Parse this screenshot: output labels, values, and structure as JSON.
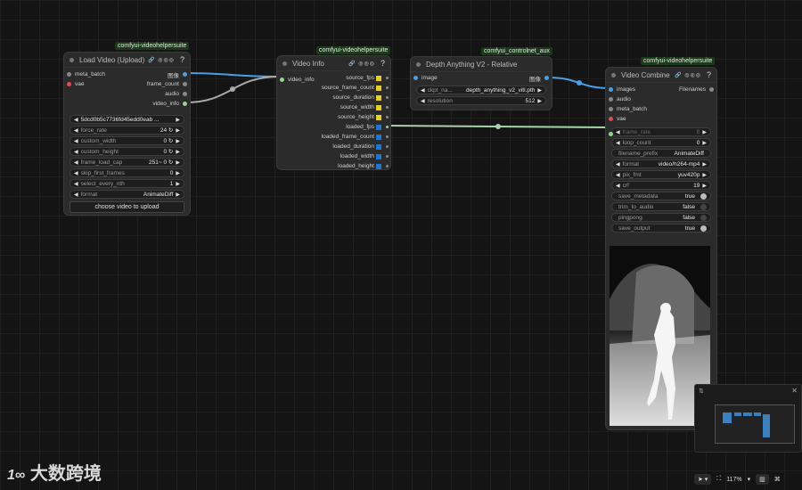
{
  "links_colors": {
    "image": "#4aa0e6",
    "info": "#aaaaaa",
    "fps": "#aad2aa"
  },
  "packs": {
    "p1": "comfyui-videohelpersuite",
    "p2": "comfyui-videohelpersuite",
    "p3": "comfyui_controlnet_aux",
    "p4": "comfyui-videohelpersuite"
  },
  "load_video": {
    "title": "Load Video (Upload)",
    "badges": "🔗 ◎◎◎",
    "help": "?",
    "inputs": [
      "meta_batch",
      "vae"
    ],
    "outputs": [
      "图像",
      "frame_count",
      "audio",
      "video_info"
    ],
    "widgets": [
      {
        "label": "",
        "value": "5dcd0b5c7736fd45edd0eab ..."
      },
      {
        "label": "force_rate",
        "value": "24 ↻"
      },
      {
        "label": "custom_width",
        "value": "0 ↻"
      },
      {
        "label": "custom_height",
        "value": "0 ↻"
      },
      {
        "label": "frame_load_cap",
        "value": "251~  0 ↻"
      },
      {
        "label": "skip_first_frames",
        "value": "0"
      },
      {
        "label": "select_every_nth",
        "value": "1"
      },
      {
        "label": "format",
        "value": "AnimateDiff"
      }
    ],
    "button": "choose video to upload"
  },
  "video_info": {
    "title": "Video Info",
    "badges": "🔗 ◎◎◎",
    "help": "?",
    "input": "video_info",
    "outputs": [
      "source_fps",
      "source_frame_count",
      "source_duration",
      "source_width",
      "source_height",
      "loaded_fps",
      "loaded_frame_count",
      "loaded_duration",
      "loaded_width",
      "loaded_height"
    ]
  },
  "depth": {
    "title": "Depth Anything V2 - Relative",
    "input": "image",
    "output": "图像",
    "widgets": [
      {
        "label": "ckpt_na...",
        "value": "depth_anything_v2_vitl.pth"
      },
      {
        "label": "resolution",
        "value": "512"
      }
    ]
  },
  "combine": {
    "title": "Video Combine",
    "badges": "🔗 ◎◎◎",
    "help": "?",
    "inputs": [
      "images",
      "audio",
      "meta_batch",
      "vae"
    ],
    "output": "Filenames",
    "widgets": [
      {
        "label": "frame_rate",
        "value": "8",
        "dim": true
      },
      {
        "label": "loop_count",
        "value": "0"
      },
      {
        "label": "filename_prefix",
        "value": "AnimateDiff"
      },
      {
        "label": "format",
        "value": "video/h264-mp4"
      },
      {
        "label": "pix_fmt",
        "value": "yuv420p"
      },
      {
        "label": "crf",
        "value": "19"
      }
    ],
    "toggles": [
      {
        "label": "save_metadata",
        "value": "true"
      },
      {
        "label": "trim_to_audio",
        "value": "false"
      },
      {
        "label": "pingpong",
        "value": "false"
      },
      {
        "label": "save_output",
        "value": "true"
      }
    ]
  },
  "toolbar": {
    "zoom": "117%"
  },
  "watermark": "大数跨境"
}
